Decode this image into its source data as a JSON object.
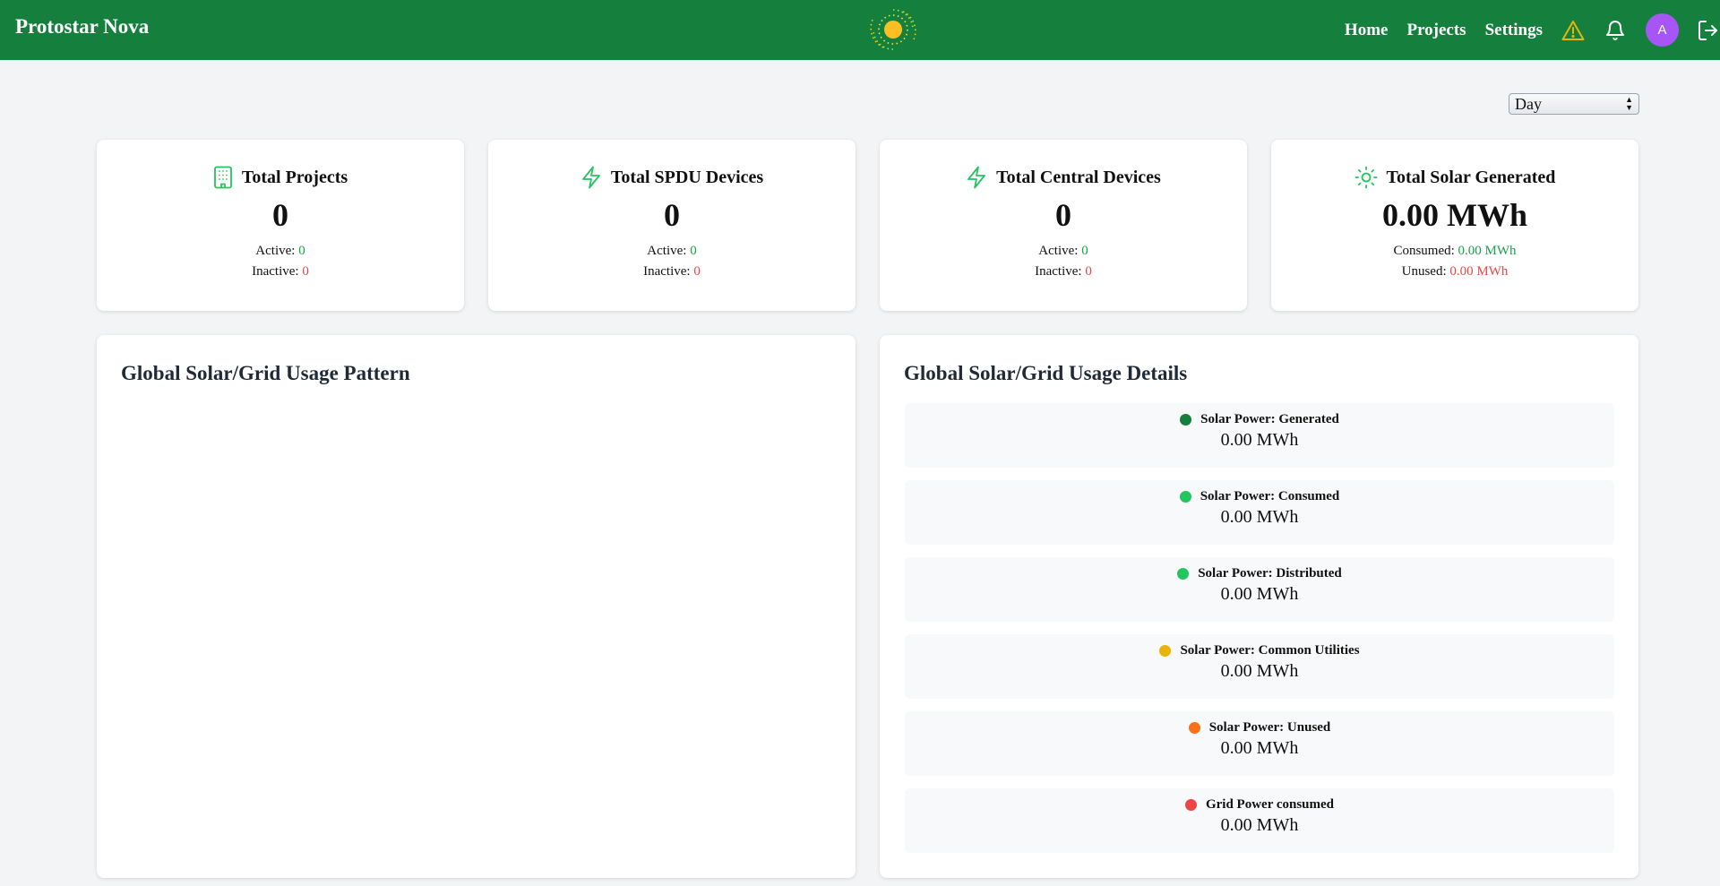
{
  "header": {
    "brand": "Protostar Nova",
    "nav": [
      {
        "label": "Home"
      },
      {
        "label": "Projects"
      },
      {
        "label": "Settings"
      }
    ],
    "avatar_initial": "A",
    "colors": {
      "bar": "#15803d",
      "warning": "#eab308",
      "avatar": "#a855f7"
    }
  },
  "filter": {
    "selected": "Day"
  },
  "stats": [
    {
      "icon": "building-icon",
      "title": "Total Projects",
      "value": "0",
      "line1_label": "Active:",
      "line1_value": "0",
      "line2_label": "Inactive:",
      "line2_value": "0"
    },
    {
      "icon": "lightning-icon",
      "title": "Total SPDU Devices",
      "value": "0",
      "line1_label": "Active:",
      "line1_value": "0",
      "line2_label": "Inactive:",
      "line2_value": "0"
    },
    {
      "icon": "lightning-icon",
      "title": "Total Central Devices",
      "value": "0",
      "line1_label": "Active:",
      "line1_value": "0",
      "line2_label": "Inactive:",
      "line2_value": "0"
    },
    {
      "icon": "sun-icon",
      "title": "Total Solar Generated",
      "value": "0.00 MWh",
      "line1_label": "Consumed:",
      "line1_value": "0.00 MWh",
      "line2_label": "Unused:",
      "line2_value": "0.00 MWh"
    }
  ],
  "pattern_panel": {
    "title": "Global Solar/Grid Usage Pattern"
  },
  "details_panel": {
    "title": "Global Solar/Grid Usage Details",
    "items": [
      {
        "label": "Solar Power: Generated",
        "value": "0.00 MWh",
        "color": "#15803d"
      },
      {
        "label": "Solar Power: Consumed",
        "value": "0.00 MWh",
        "color": "#22c55e"
      },
      {
        "label": "Solar Power: Distributed",
        "value": "0.00 MWh",
        "color": "#22c55e"
      },
      {
        "label": "Solar Power: Common Utilities",
        "value": "0.00 MWh",
        "color": "#eab308"
      },
      {
        "label": "Solar Power: Unused",
        "value": "0.00 MWh",
        "color": "#f97316"
      },
      {
        "label": "Grid Power consumed",
        "value": "0.00 MWh",
        "color": "#ef4444"
      }
    ]
  }
}
